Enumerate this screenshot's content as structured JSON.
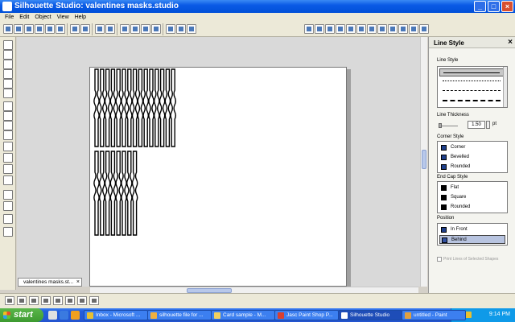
{
  "window": {
    "title": "Silhouette Studio: valentines masks.studio",
    "buttons": [
      "_",
      "□",
      "×"
    ]
  },
  "menu": [
    "File",
    "Edit",
    "Object",
    "View",
    "Help"
  ],
  "toolbar_icons": [
    "new-icon",
    "open-icon",
    "save-icon",
    "print-icon",
    "cut-icon",
    "copy-icon",
    "paste-icon",
    "undo-icon",
    "redo-icon",
    "zoom-in-icon",
    "zoom-out-icon",
    "zoom-fit-icon",
    "pan-icon",
    "page-icon",
    "select-icon",
    "group-icon",
    "ungroup-icon",
    "fill-icon",
    "line-color-icon",
    "line-style-icon",
    "text-icon",
    "align-icon",
    "replicate-icon",
    "weld-icon",
    "offset-icon",
    "trace-icon",
    "knife-icon",
    "cut-settings-icon",
    "send-icon"
  ],
  "document_tab": {
    "name": "valentines masks.st...",
    "close": "×"
  },
  "panel": {
    "title": "Line Style",
    "close": "×",
    "line_style_label": "Line Style",
    "thickness_label": "Line Thickness",
    "thickness_value": "1.50",
    "thickness_unit": "pt",
    "corner_label": "Corner Style",
    "corner_options": [
      "Corner",
      "Bevelled",
      "Rounded"
    ],
    "endcap_label": "End Cap Style",
    "endcap_options": [
      "Flat",
      "Square",
      "Rounded"
    ],
    "position_label": "Position",
    "position_options": [
      "In Front",
      "Behind"
    ],
    "position_selected": "Behind",
    "print_lines_label": "Print Lines of Selected Shapes"
  },
  "taskbar": {
    "start": "start",
    "tasks": [
      {
        "label": "Inbox - Microsoft ...",
        "color": "#e8c030"
      },
      {
        "label": "silhouette file for ...",
        "color": "#f0b040"
      },
      {
        "label": "Card sample - M...",
        "color": "#f0d060"
      },
      {
        "label": "Jasc Paint Shop P...",
        "color": "#d84030"
      },
      {
        "label": "Silhouette Studio",
        "color": "#ffffff",
        "active": true
      },
      {
        "label": "untitled - Paint",
        "color": "#e0a040"
      }
    ],
    "clock": "9:14 PM"
  },
  "colors": {
    "title_blue": "#0a5ae6",
    "taskbar_blue": "#245edc",
    "start_green": "#3d9a30",
    "selected_option": "#b8c4e0"
  }
}
